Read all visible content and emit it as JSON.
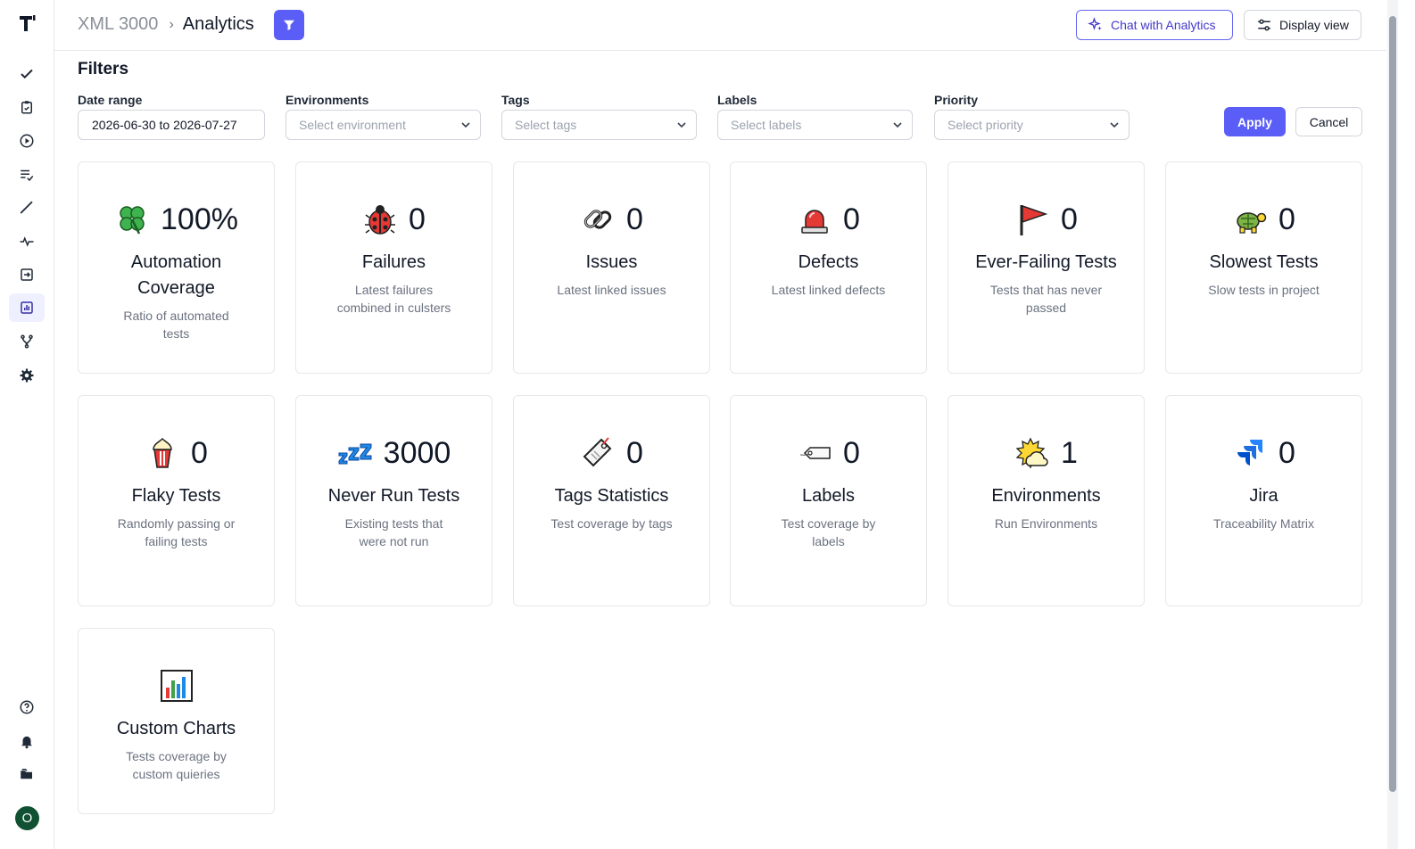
{
  "header": {
    "project": "XML 3000",
    "separator": "›",
    "page": "Analytics",
    "chat_label": "Chat with Analytics",
    "display_label": "Display view"
  },
  "filters": {
    "title": "Filters",
    "date_range": {
      "label": "Date range",
      "value": "2026-06-30 to 2026-07-27"
    },
    "environments": {
      "label": "Environments",
      "placeholder": "Select environment"
    },
    "tags": {
      "label": "Tags",
      "placeholder": "Select tags"
    },
    "labels": {
      "label": "Labels",
      "placeholder": "Select labels"
    },
    "priority": {
      "label": "Priority",
      "placeholder": "Select priority"
    },
    "apply_label": "Apply",
    "cancel_label": "Cancel"
  },
  "cards": [
    {
      "icon": "clover-icon",
      "value": "100%",
      "title": "Automation Coverage",
      "desc": "Ratio of automated tests"
    },
    {
      "icon": "ladybug-icon",
      "value": "0",
      "title": "Failures",
      "desc": "Latest failures combined in culsters"
    },
    {
      "icon": "link-icon",
      "value": "0",
      "title": "Issues",
      "desc": "Latest linked issues"
    },
    {
      "icon": "siren-icon",
      "value": "0",
      "title": "Defects",
      "desc": "Latest linked defects"
    },
    {
      "icon": "flag-icon",
      "value": "0",
      "title": "Ever-Failing Tests",
      "desc": "Tests that has never passed"
    },
    {
      "icon": "turtle-icon",
      "value": "0",
      "title": "Slowest Tests",
      "desc": "Slow tests in project"
    },
    {
      "icon": "popcorn-icon",
      "value": "0",
      "title": "Flaky Tests",
      "desc": "Randomly passing or failing tests"
    },
    {
      "icon": "zzz-icon",
      "value": "3000",
      "title": "Never Run Tests",
      "desc": "Existing tests that were not run"
    },
    {
      "icon": "tag-icon",
      "value": "0",
      "title": "Tags Statistics",
      "desc": "Test coverage by tags"
    },
    {
      "icon": "label-icon",
      "value": "0",
      "title": "Labels",
      "desc": "Test coverage by labels"
    },
    {
      "icon": "sun-cloud-icon",
      "value": "1",
      "title": "Environments",
      "desc": "Run Environments"
    },
    {
      "icon": "jira-icon",
      "value": "0",
      "title": "Jira",
      "desc": "Traceability Matrix"
    },
    {
      "icon": "bar-chart-icon",
      "value": "",
      "title": "Custom Charts",
      "desc": "Tests coverage by custom quieries"
    }
  ],
  "user": {
    "avatar_initial": "O",
    "avatar_color": "#0f5132"
  },
  "colors": {
    "accent": "#5b5ef6",
    "border": "#e5e7eb",
    "muted_text": "#6b7280"
  }
}
